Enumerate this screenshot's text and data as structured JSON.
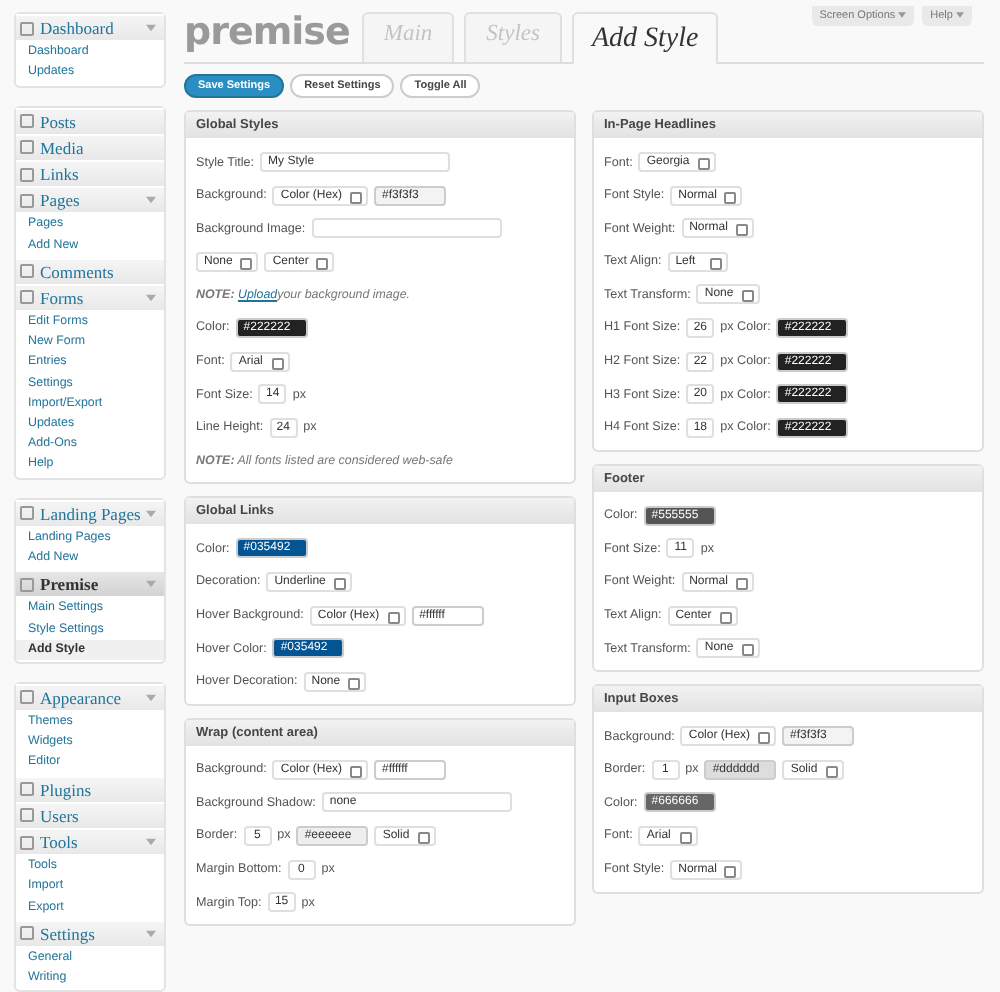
{
  "sidebar": {
    "groups": [
      [
        {
          "label": "Dashboard",
          "selected": false,
          "expanded": true,
          "children": [
            {
              "label": "Dashboard",
              "selected": false
            },
            {
              "label": "Updates",
              "selected": false
            }
          ]
        }
      ],
      [
        {
          "label": "Posts",
          "selected": false
        },
        {
          "label": "Media",
          "selected": false
        },
        {
          "label": "Links",
          "selected": false
        },
        {
          "label": "Pages",
          "selected": false,
          "expanded": true,
          "children": [
            {
              "label": "Pages",
              "selected": false
            },
            {
              "label": "Add New",
              "selected": false
            }
          ]
        },
        {
          "label": "Comments",
          "selected": false
        },
        {
          "label": "Forms",
          "selected": false,
          "expanded": true,
          "children": [
            {
              "label": "Edit Forms",
              "selected": false
            },
            {
              "label": "New Form",
              "selected": false
            },
            {
              "label": "Entries",
              "selected": false
            },
            {
              "label": "Settings",
              "selected": false
            },
            {
              "label": "Import/Export",
              "selected": false
            },
            {
              "label": "Updates",
              "selected": false
            },
            {
              "label": "Add-Ons",
              "selected": false
            },
            {
              "label": "Help",
              "selected": false
            }
          ]
        }
      ],
      [
        {
          "label": "Landing Pages",
          "selected": false,
          "expanded": true,
          "children": [
            {
              "label": "Landing Pages",
              "selected": false
            },
            {
              "label": "Add New",
              "selected": false
            }
          ]
        },
        {
          "label": "Premise",
          "selected": true,
          "expanded": true,
          "children": [
            {
              "label": "Main Settings",
              "selected": false
            },
            {
              "label": "Style Settings",
              "selected": false
            },
            {
              "label": "Add Style",
              "selected": true
            }
          ]
        }
      ],
      [
        {
          "label": "Appearance",
          "selected": false,
          "expanded": true,
          "children": [
            {
              "label": "Themes",
              "selected": false
            },
            {
              "label": "Widgets",
              "selected": false
            },
            {
              "label": "Editor",
              "selected": false
            }
          ]
        },
        {
          "label": "Plugins",
          "selected": false
        },
        {
          "label": "Users",
          "selected": false
        },
        {
          "label": "Tools",
          "selected": false,
          "expanded": true,
          "children": [
            {
              "label": "Tools",
              "selected": false
            },
            {
              "label": "Import",
              "selected": false
            },
            {
              "label": "Export",
              "selected": false
            }
          ]
        },
        {
          "label": "Settings",
          "selected": false,
          "expanded": true,
          "children": [
            {
              "label": "General",
              "selected": false
            },
            {
              "label": "Writing",
              "selected": false
            }
          ]
        }
      ]
    ]
  },
  "logo": "premise",
  "tabs": [
    {
      "label": "Main",
      "selected": false
    },
    {
      "label": "Styles",
      "selected": false
    },
    {
      "label": "Add Style",
      "selected": true
    }
  ],
  "top_links": [
    "Screen Options",
    "Help"
  ],
  "buttons": [
    {
      "label": "Save Settings",
      "primary": true
    },
    {
      "label": "Reset Settings",
      "primary": false
    },
    {
      "label": "Toggle All",
      "primary": false
    }
  ],
  "columns": [
    [
      {
        "title": "Global Styles",
        "rows": [
          {
            "parts": [
              {
                "kind": "label",
                "text": "Style Title:"
              },
              {
                "kind": "text",
                "value": "My Style"
              }
            ]
          },
          {
            "parts": [
              {
                "kind": "label",
                "text": "Background:"
              },
              {
                "kind": "select",
                "value": "Color (Hex)"
              },
              {
                "kind": "color",
                "value": "#f3f3f3",
                "color": "#f3f3f3"
              }
            ]
          },
          {
            "parts": [
              {
                "kind": "label",
                "text": "Background Image:"
              },
              {
                "kind": "text"
              }
            ]
          },
          {
            "parts": [
              {
                "kind": "select",
                "value": "None"
              },
              {
                "kind": "select",
                "value": "Center"
              }
            ]
          },
          {
            "parts": [
              {
                "kind": "note",
                "lead": "NOTE:",
                "link": "Upload",
                "text": "your background image."
              }
            ]
          },
          {
            "parts": [
              {
                "kind": "label",
                "text": "Color:"
              },
              {
                "kind": "color",
                "value": "#222222",
                "color": "#222222"
              }
            ]
          },
          {
            "parts": [
              {
                "kind": "label",
                "text": "Font:"
              },
              {
                "kind": "select",
                "value": "Arial"
              }
            ]
          },
          {
            "parts": [
              {
                "kind": "label",
                "text": "Font Size:"
              },
              {
                "kind": "number",
                "value": "14"
              },
              {
                "kind": "label",
                "text": "px"
              }
            ]
          },
          {
            "parts": [
              {
                "kind": "label",
                "text": "Line Height:"
              },
              {
                "kind": "number",
                "value": "24"
              },
              {
                "kind": "label",
                "text": "px"
              }
            ]
          },
          {
            "parts": [
              {
                "kind": "note",
                "lead": "NOTE:",
                "text": "All fonts listed are considered web-safe"
              }
            ]
          }
        ]
      },
      {
        "title": "Global Links",
        "rows": [
          {
            "parts": [
              {
                "kind": "label",
                "text": "Color:"
              },
              {
                "kind": "color",
                "value": "#035492",
                "color": "#035492"
              }
            ]
          },
          {
            "parts": [
              {
                "kind": "label",
                "text": "Decoration:"
              },
              {
                "kind": "select",
                "value": "Underline"
              }
            ]
          },
          {
            "parts": [
              {
                "kind": "label",
                "text": "Hover Background:"
              },
              {
                "kind": "select",
                "value": "Color (Hex)"
              },
              {
                "kind": "color",
                "value": "#ffffff",
                "color": "#ffffff"
              }
            ]
          },
          {
            "parts": [
              {
                "kind": "label",
                "text": "Hover Color:"
              },
              {
                "kind": "color",
                "value": "#035492",
                "color": "#035492"
              }
            ]
          },
          {
            "parts": [
              {
                "kind": "label",
                "text": "Hover Decoration:"
              },
              {
                "kind": "select",
                "value": "None"
              }
            ]
          }
        ]
      },
      {
        "title": "Wrap (content area)",
        "rows": [
          {
            "parts": [
              {
                "kind": "label",
                "text": "Background:"
              },
              {
                "kind": "select",
                "value": "Color (Hex)"
              },
              {
                "kind": "color",
                "value": "#ffffff",
                "color": "#ffffff"
              }
            ]
          },
          {
            "parts": [
              {
                "kind": "label",
                "text": "Background Shadow:"
              },
              {
                "kind": "text",
                "value": "none"
              }
            ]
          },
          {
            "parts": [
              {
                "kind": "label",
                "text": "Border:"
              },
              {
                "kind": "number",
                "value": "5"
              },
              {
                "kind": "label",
                "text": "px"
              },
              {
                "kind": "color",
                "value": "#eeeeee",
                "color": "#eeeeee"
              },
              {
                "kind": "select",
                "value": "Solid"
              }
            ]
          },
          {
            "parts": [
              {
                "kind": "label",
                "text": "Margin Bottom:"
              },
              {
                "kind": "number",
                "value": "0"
              },
              {
                "kind": "label",
                "text": "px"
              }
            ]
          },
          {
            "parts": [
              {
                "kind": "label",
                "text": "Margin Top:"
              },
              {
                "kind": "number",
                "value": "15"
              },
              {
                "kind": "label",
                "text": "px"
              }
            ]
          }
        ]
      }
    ],
    [
      {
        "title": "In-Page Headlines",
        "rows": [
          {
            "parts": [
              {
                "kind": "label",
                "text": "Font:"
              },
              {
                "kind": "select",
                "value": "Georgia"
              }
            ]
          },
          {
            "parts": [
              {
                "kind": "label",
                "text": "Font Style:"
              },
              {
                "kind": "select",
                "value": "Normal"
              }
            ]
          },
          {
            "parts": [
              {
                "kind": "label",
                "text": "Font Weight:"
              },
              {
                "kind": "select",
                "value": "Normal"
              }
            ]
          },
          {
            "parts": [
              {
                "kind": "label",
                "text": "Text Align:"
              },
              {
                "kind": "select",
                "value": "Left"
              }
            ]
          },
          {
            "parts": [
              {
                "kind": "label",
                "text": "Text Transform:"
              },
              {
                "kind": "select",
                "value": "None"
              }
            ]
          },
          {
            "parts": [
              {
                "kind": "label",
                "text": "H1 Font Size:"
              },
              {
                "kind": "number",
                "value": "26"
              },
              {
                "kind": "label",
                "text": "px Color:"
              },
              {
                "kind": "color",
                "value": "#222222",
                "color": "#222222"
              }
            ]
          },
          {
            "parts": [
              {
                "kind": "label",
                "text": "H2 Font Size:"
              },
              {
                "kind": "number",
                "value": "22"
              },
              {
                "kind": "label",
                "text": "px Color:"
              },
              {
                "kind": "color",
                "value": "#222222",
                "color": "#222222"
              }
            ]
          },
          {
            "parts": [
              {
                "kind": "label",
                "text": "H3 Font Size:"
              },
              {
                "kind": "number",
                "value": "20"
              },
              {
                "kind": "label",
                "text": "px Color:"
              },
              {
                "kind": "color",
                "value": "#222222",
                "color": "#222222"
              }
            ]
          },
          {
            "parts": [
              {
                "kind": "label",
                "text": "H4 Font Size:"
              },
              {
                "kind": "number",
                "value": "18"
              },
              {
                "kind": "label",
                "text": "px Color:"
              },
              {
                "kind": "color",
                "value": "#222222",
                "color": "#222222"
              }
            ]
          }
        ]
      },
      {
        "title": "Footer",
        "rows": [
          {
            "parts": [
              {
                "kind": "label",
                "text": "Color:"
              },
              {
                "kind": "color",
                "value": "#555555",
                "color": "#555555"
              }
            ]
          },
          {
            "parts": [
              {
                "kind": "label",
                "text": "Font Size:"
              },
              {
                "kind": "number",
                "value": "11"
              },
              {
                "kind": "label",
                "text": "px"
              }
            ]
          },
          {
            "parts": [
              {
                "kind": "label",
                "text": "Font Weight:"
              },
              {
                "kind": "select",
                "value": "Normal"
              }
            ]
          },
          {
            "parts": [
              {
                "kind": "label",
                "text": "Text Align:"
              },
              {
                "kind": "select",
                "value": "Center"
              }
            ]
          },
          {
            "parts": [
              {
                "kind": "label",
                "text": "Text Transform:"
              },
              {
                "kind": "select",
                "value": "None"
              }
            ]
          }
        ]
      },
      {
        "title": "Input Boxes",
        "rows": [
          {
            "parts": [
              {
                "kind": "label",
                "text": "Background:"
              },
              {
                "kind": "select",
                "value": "Color (Hex)"
              },
              {
                "kind": "color",
                "value": "#f3f3f3",
                "color": "#f3f3f3"
              }
            ]
          },
          {
            "parts": [
              {
                "kind": "label",
                "text": "Border:"
              },
              {
                "kind": "number",
                "value": "1"
              },
              {
                "kind": "label",
                "text": "px"
              },
              {
                "kind": "color",
                "value": "#dddddd",
                "color": "#dddddd"
              },
              {
                "kind": "select",
                "value": "Solid"
              }
            ]
          },
          {
            "parts": [
              {
                "kind": "label",
                "text": "Color:"
              },
              {
                "kind": "color",
                "value": "#666666",
                "color": "#666666"
              }
            ]
          },
          {
            "parts": [
              {
                "kind": "label",
                "text": "Font:"
              },
              {
                "kind": "select",
                "value": "Arial"
              }
            ]
          },
          {
            "parts": [
              {
                "kind": "label",
                "text": "Font Style:"
              },
              {
                "kind": "select",
                "value": "Normal"
              }
            ]
          }
        ]
      }
    ]
  ]
}
